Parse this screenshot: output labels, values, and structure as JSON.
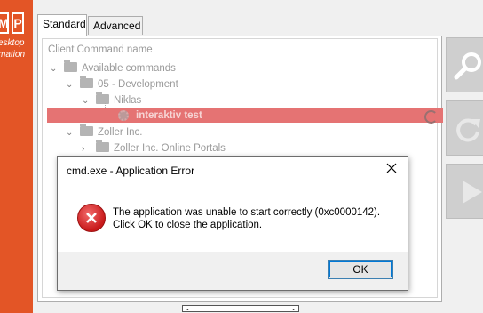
{
  "brand": {
    "letters": [
      "M",
      "P"
    ],
    "line1": "esktop",
    "line2": "mation"
  },
  "tabs": [
    {
      "label": "Standard"
    },
    {
      "label": "Advanced"
    }
  ],
  "tree": {
    "header": "Client Command name",
    "nodes": [
      {
        "label": "Available commands"
      },
      {
        "label": "05 - Development"
      },
      {
        "label": "Niklas"
      },
      {
        "label": "interaktiv test"
      },
      {
        "label": "Zoller Inc."
      },
      {
        "label": "Zoller Inc. Online Portals"
      }
    ]
  },
  "side_buttons": [
    {
      "icon": "search-icon"
    },
    {
      "icon": "refresh-icon"
    },
    {
      "icon": "play-icon"
    }
  ],
  "dialog": {
    "title": "cmd.exe - Application Error",
    "message_line1": "The application was unable to start correctly (0xc0000142).",
    "message_line2": "Click OK to close the application.",
    "ok_label": "OK",
    "icon": "error-icon"
  },
  "colors": {
    "brand": "#e35526",
    "selection": "#e57373",
    "error": "#c8191a"
  }
}
